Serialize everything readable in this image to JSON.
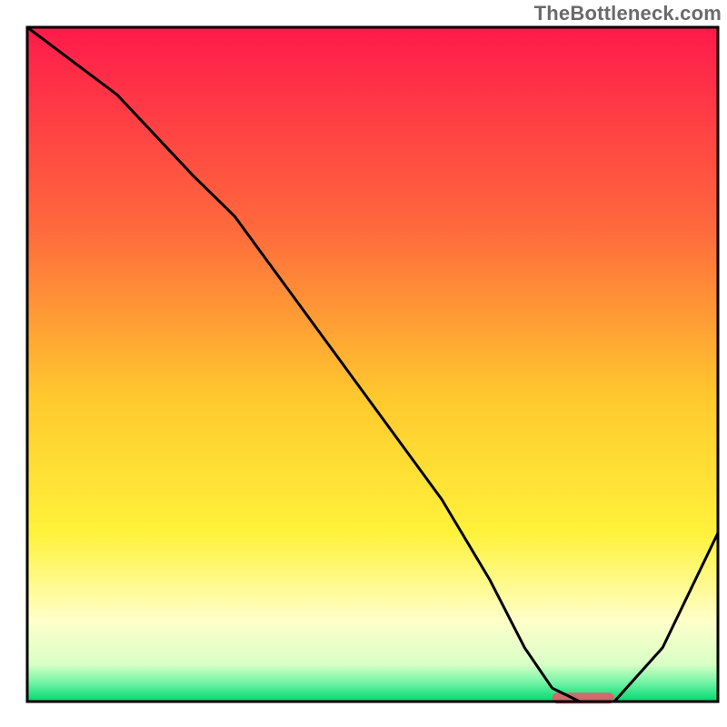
{
  "watermark": "TheBottleneck.com",
  "chart_data": {
    "type": "line",
    "title": "",
    "xlabel": "",
    "ylabel": "",
    "xlim": [
      0,
      100
    ],
    "ylim": [
      0,
      100
    ],
    "grid": false,
    "background_gradient": {
      "stops": [
        {
          "offset": 0.0,
          "color": "#ff1a4b"
        },
        {
          "offset": 0.3,
          "color": "#ff6a3c"
        },
        {
          "offset": 0.55,
          "color": "#ffc92e"
        },
        {
          "offset": 0.75,
          "color": "#fff23a"
        },
        {
          "offset": 0.88,
          "color": "#ffffc9"
        },
        {
          "offset": 0.945,
          "color": "#d9ffc6"
        },
        {
          "offset": 0.97,
          "color": "#79f5a7"
        },
        {
          "offset": 1.0,
          "color": "#00d86f"
        }
      ]
    },
    "series": [
      {
        "name": "bottleneck-curve",
        "x": [
          0,
          13,
          24,
          30,
          40,
          50,
          60,
          67,
          72,
          76,
          80,
          85,
          92,
          100
        ],
        "values": [
          100,
          90,
          78,
          72,
          58,
          44,
          30,
          18,
          8,
          2,
          0,
          0,
          8,
          25
        ]
      }
    ],
    "marker": {
      "name": "optimal-range-marker",
      "x_start": 76,
      "x_end": 85,
      "y": 0.5,
      "color": "#cf6a6f"
    },
    "frame": {
      "color": "#000000",
      "width": 3
    }
  }
}
